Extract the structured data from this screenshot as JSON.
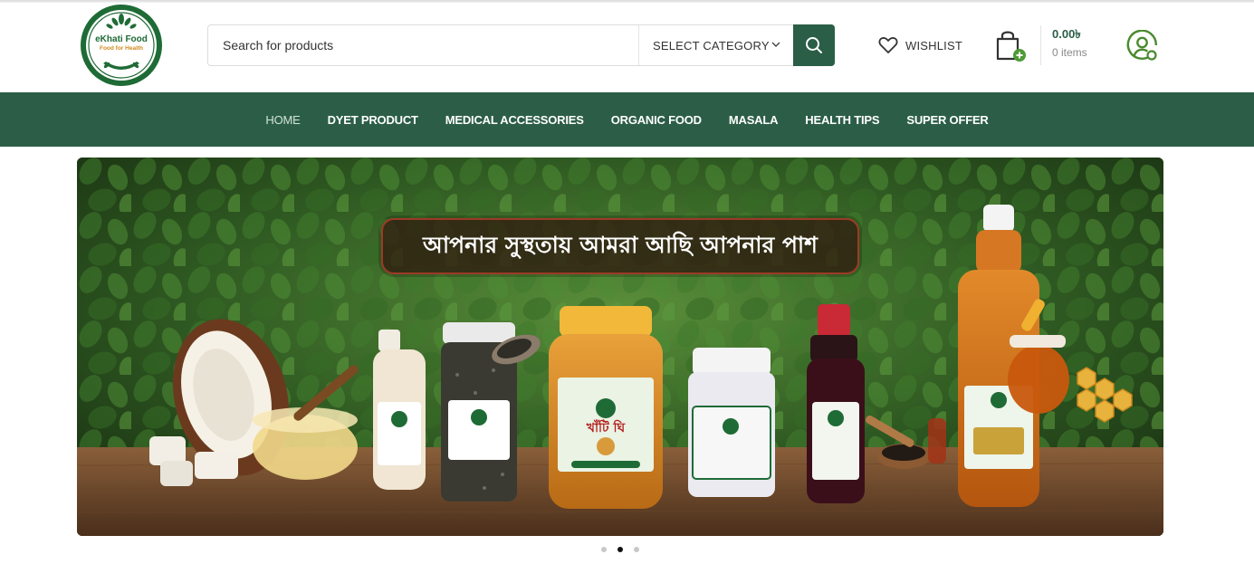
{
  "brand": {
    "logo_name": "eKhati Food",
    "logo_tagline": "Food for Health",
    "primary_color": "#2c5e47",
    "accent_color": "#d18b1c"
  },
  "header": {
    "search_placeholder": "Search for products",
    "category_label": "SELECT CATEGORY",
    "search_icon": "search-icon",
    "wishlist_label": "WISHLIST",
    "wishlist_icon": "heart-icon",
    "cart_icon": "shopping-bag-icon",
    "cart_total": "0.00৳",
    "cart_count": "0 items",
    "account_icon": "user-icon"
  },
  "nav": {
    "items": [
      {
        "label": "HOME"
      },
      {
        "label": "DYET PRODUCT"
      },
      {
        "label": "MEDICAL ACCESSORIES"
      },
      {
        "label": "ORGANIC FOOD"
      },
      {
        "label": "MASALA"
      },
      {
        "label": "HEALTH TIPS"
      },
      {
        "label": "SUPER OFFER"
      }
    ],
    "active_index": 0
  },
  "banner": {
    "headline": "আপনার সুস্থতায় আমরা আছি আপনার পাশ",
    "jar_label": "খাঁটি ঘি",
    "slides_total": 3,
    "active_slide": 2
  }
}
